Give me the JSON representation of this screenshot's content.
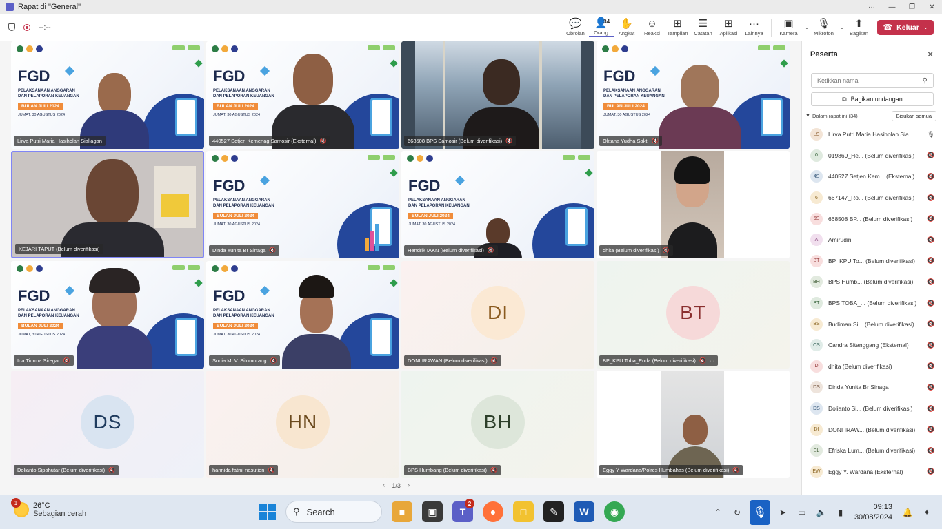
{
  "window": {
    "title": "Rapat di \"General\"",
    "more": "···",
    "minimize": "—",
    "maximize": "❐",
    "close": "✕"
  },
  "toolbar": {
    "timer": "--:--",
    "items": [
      {
        "label": "Obrolan",
        "icon": "💬"
      },
      {
        "label": "Orang",
        "icon": "👤",
        "count": "34"
      },
      {
        "label": "Angkat",
        "icon": "✋"
      },
      {
        "label": "Reaksi",
        "icon": "☺"
      },
      {
        "label": "Tampilan",
        "icon": "⊞"
      },
      {
        "label": "Catatan",
        "icon": "☰"
      },
      {
        "label": "Aplikasi",
        "icon": "⊞"
      },
      {
        "label": "Lainnya",
        "icon": "···"
      }
    ],
    "camera": "Kamera",
    "mic": "Mikrofon",
    "share": "Bagikan",
    "leave": "Keluar"
  },
  "slide": {
    "fgd": "FGD",
    "subtitle_1": "PELAKSANAAN ANGGARAN",
    "subtitle_2": "DAN PELAPORAN KEUANGAN",
    "month": "BULAN JULI 2024",
    "date": "JUMAT, 30 AGUSTUS 2024"
  },
  "tiles": [
    {
      "name": "Lirva Putri Maria Hasiholan Siallagan"
    },
    {
      "name": "440527 Setjen Kemenag Samosir (Eksternal)"
    },
    {
      "name": "668508 BPS Samosir (Belum diverifikasi)"
    },
    {
      "name": "Oktana Yudha Sakti"
    },
    {
      "name": "KEJARI TAPUT (Belum diverifikasi)"
    },
    {
      "name": "Dinda Yunita Br Sinaga"
    },
    {
      "name": "Hendrik IAKN (Belum diverifikasi)"
    },
    {
      "name": "dhita (Belum diverifikasi)"
    },
    {
      "name": "Ida Tiurma Siregar"
    },
    {
      "name": "Sonia M. V. Situmorang"
    },
    {
      "name": "DONI IRAWAN (Belum diverifikasi)",
      "initials": "DI"
    },
    {
      "name": "BP_KPU Toba_Enda (Belum diverifikasi)",
      "initials": "BT",
      "more": "···"
    },
    {
      "name": "Dolianto Sipahutar (Belum diverifikasi)",
      "initials": "DS"
    },
    {
      "name": "hannida fatmi nasution",
      "initials": "HN"
    },
    {
      "name": "BPS Humbang (Belum diverifikasi)",
      "initials": "BH"
    },
    {
      "name": "Eggy Y Wardana/Polres Humbahas (Belum diverifikasi)"
    }
  ],
  "pager": {
    "label": "1/3"
  },
  "panel": {
    "title": "Peserta",
    "search_placeholder": "Ketikkan nama",
    "invite": "Bagikan undangan",
    "section": "Dalam rapat ini (34)",
    "mute_all": "Bisukan semua",
    "participants": [
      {
        "initials": "LS",
        "name": "Lirva Putri Maria Hasiholan Sia...",
        "bg": "#f3e4d6",
        "fg": "#8a5a2b"
      },
      {
        "initials": "0",
        "name": "019869_He...  (Belum diverifikasi)",
        "bg": "#dfeadf",
        "fg": "#2f5d33"
      },
      {
        "initials": "4S",
        "name": "440527 Setjen Kem...  (Eksternal)",
        "bg": "#dde6f0",
        "fg": "#335577"
      },
      {
        "initials": "6",
        "name": "667147_Ro...  (Belum diverifikasi)",
        "bg": "#f7ead2",
        "fg": "#8a6420"
      },
      {
        "initials": "6S",
        "name": "668508 BP...  (Belum diverifikasi)",
        "bg": "#f8dede",
        "fg": "#963a3a"
      },
      {
        "initials": "A",
        "name": "Amirudin",
        "bg": "#f1dfee",
        "fg": "#7a3670"
      },
      {
        "initials": "BT",
        "name": "BP_KPU To...  (Belum diverifikasi)",
        "bg": "#f8dede",
        "fg": "#963a3a"
      },
      {
        "initials": "BH",
        "name": "BPS Humb...  (Belum diverifikasi)",
        "bg": "#e2eadf",
        "fg": "#3d5a33"
      },
      {
        "initials": "BT",
        "name": "BPS TOBA_...  (Belum diverifikasi)",
        "bg": "#dfeadf",
        "fg": "#2f5d33"
      },
      {
        "initials": "BS",
        "name": "Budiman Si...  (Belum diverifikasi)",
        "bg": "#f7ead2",
        "fg": "#8a6420"
      },
      {
        "initials": "CS",
        "name": "Candra Sitanggang (Eksternal)",
        "bg": "#e0ece8",
        "fg": "#2f5d52"
      },
      {
        "initials": "D",
        "name": "dhita (Belum diverifikasi)",
        "bg": "#f8dede",
        "fg": "#963a3a"
      },
      {
        "initials": "DS",
        "name": "Dinda Yunita Br Sinaga",
        "bg": "#eee4dc",
        "fg": "#6b4a33"
      },
      {
        "initials": "DS",
        "name": "Dolianto Si...  (Belum diverifikasi)",
        "bg": "#dde6f0",
        "fg": "#335577"
      },
      {
        "initials": "DI",
        "name": "DONI IRAW...  (Belum diverifikasi)",
        "bg": "#f7ead2",
        "fg": "#8a6420"
      },
      {
        "initials": "EL",
        "name": "Efriska Lum...  (Belum diverifikasi)",
        "bg": "#e2eadf",
        "fg": "#3d5a33"
      },
      {
        "initials": "EW",
        "name": "Eggy Y. Wardana (Eksternal)",
        "bg": "#f7ead2",
        "fg": "#8a6420"
      }
    ]
  },
  "taskbar": {
    "weather_badge": "1",
    "temp": "26°C",
    "condition": "Sebagian cerah",
    "search": "Search",
    "teams_badge": "2",
    "time": "09:13",
    "date": "30/08/2024"
  }
}
